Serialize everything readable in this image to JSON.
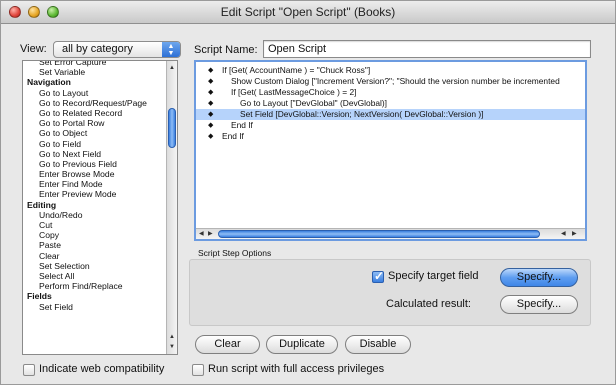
{
  "window": {
    "title": "Edit Script \"Open Script\" (Books)"
  },
  "view": {
    "label": "View:",
    "selected": "all by category"
  },
  "script_name": {
    "label": "Script Name:",
    "value": "Open Script"
  },
  "steps": [
    {
      "label": "Set Error Capture",
      "kind": "sub"
    },
    {
      "label": "Set Variable",
      "kind": "sub"
    },
    {
      "label": "Navigation",
      "kind": "cat"
    },
    {
      "label": "Go to Layout",
      "kind": "sub"
    },
    {
      "label": "Go to Record/Request/Page",
      "kind": "sub"
    },
    {
      "label": "Go to Related Record",
      "kind": "sub"
    },
    {
      "label": "Go to Portal Row",
      "kind": "sub"
    },
    {
      "label": "Go to Object",
      "kind": "sub"
    },
    {
      "label": "Go to Field",
      "kind": "sub"
    },
    {
      "label": "Go to Next Field",
      "kind": "sub"
    },
    {
      "label": "Go to Previous Field",
      "kind": "sub"
    },
    {
      "label": "Enter Browse Mode",
      "kind": "sub"
    },
    {
      "label": "Enter Find Mode",
      "kind": "sub"
    },
    {
      "label": "Enter Preview Mode",
      "kind": "sub"
    },
    {
      "label": "Editing",
      "kind": "cat"
    },
    {
      "label": "Undo/Redo",
      "kind": "sub"
    },
    {
      "label": "Cut",
      "kind": "sub"
    },
    {
      "label": "Copy",
      "kind": "sub"
    },
    {
      "label": "Paste",
      "kind": "sub"
    },
    {
      "label": "Clear",
      "kind": "sub"
    },
    {
      "label": "Set Selection",
      "kind": "sub"
    },
    {
      "label": "Select All",
      "kind": "sub"
    },
    {
      "label": "Perform Find/Replace",
      "kind": "sub"
    },
    {
      "label": "Fields",
      "kind": "cat"
    },
    {
      "label": "Set Field",
      "kind": "sub"
    }
  ],
  "script_lines": [
    {
      "text": "If [Get( AccountName ) = \"Chuck Ross\"]",
      "indent": 0,
      "selected": false
    },
    {
      "text": "Show Custom Dialog [\"Increment Version?\"; \"Should the version number be incremented",
      "indent": 1,
      "selected": false
    },
    {
      "text": "If [Get( LastMessageChoice ) = 2]",
      "indent": 1,
      "selected": false
    },
    {
      "text": "Go to Layout [\"DevGlobal\" (DevGlobal)]",
      "indent": 2,
      "selected": false
    },
    {
      "text": "Set Field [DevGlobal::Version; NextVersion( DevGlobal::Version )]",
      "indent": 2,
      "selected": true
    },
    {
      "text": "End If",
      "indent": 1,
      "selected": false
    },
    {
      "text": "End If",
      "indent": 0,
      "selected": false
    }
  ],
  "options": {
    "section_label": "Script Step Options",
    "specify_target": {
      "label": "Specify target field",
      "checked": true
    },
    "specify_button": "Specify...",
    "calculated_label": "Calculated result:",
    "calculated_button": "Specify..."
  },
  "actions": {
    "clear": "Clear",
    "duplicate": "Duplicate",
    "disable": "Disable"
  },
  "footer": {
    "web_compat": {
      "label": "Indicate web compatibility",
      "checked": false
    },
    "full_access": {
      "label": "Run script with full access privileges",
      "checked": false
    }
  },
  "colors": {
    "selection": "#b6d3fb",
    "accent": "#3f86e8"
  }
}
